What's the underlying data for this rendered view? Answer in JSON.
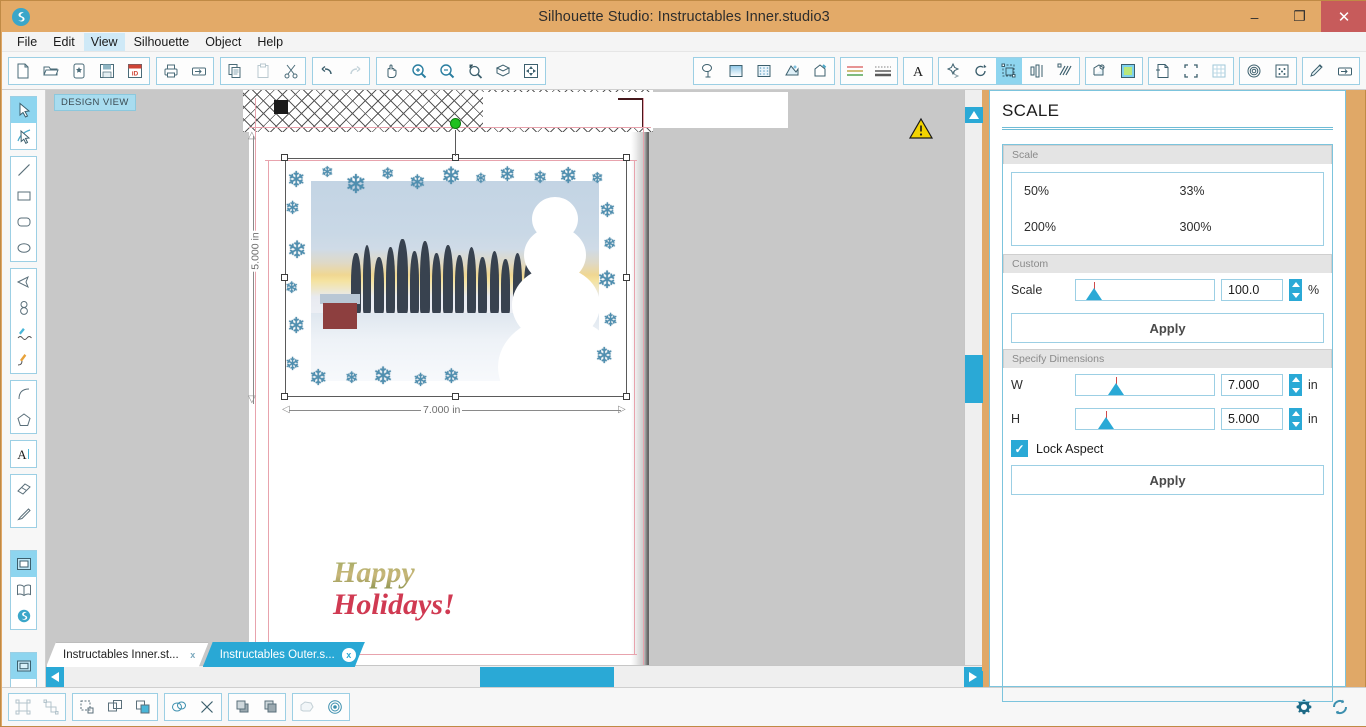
{
  "window": {
    "title": "Silhouette Studio: Instructables Inner.studio3",
    "logo_icon": "silhouette-logo-icon",
    "minimize_label": "–",
    "maximize_label": "❐",
    "close_label": "✕"
  },
  "menu": {
    "items": [
      {
        "label": "File",
        "active": false
      },
      {
        "label": "Edit",
        "active": false
      },
      {
        "label": "View",
        "active": true
      },
      {
        "label": "Silhouette",
        "active": false
      },
      {
        "label": "Object",
        "active": false
      },
      {
        "label": "Help",
        "active": false
      }
    ]
  },
  "toolbar_left": [
    {
      "icons": [
        "new-document-icon",
        "open-folder-icon",
        "open-library-icon",
        "save-icon",
        "save-to-library-icon"
      ]
    },
    {
      "icons": [
        "print-icon",
        "send-to-silhouette-icon"
      ]
    },
    {
      "icons": [
        "copy-icon",
        "paste-icon",
        "cut-scissors-icon"
      ]
    },
    {
      "icons": [
        "undo-icon",
        "redo-icon"
      ]
    },
    {
      "icons": [
        "pan-hand-icon",
        "zoom-in-icon",
        "zoom-out-icon",
        "zoom-selection-icon",
        "zoom-region-icon",
        "fit-to-window-icon"
      ]
    }
  ],
  "toolbar_right": [
    {
      "icons": [
        "cut-settings-icon",
        "fill-color-icon",
        "fill-pattern-icon",
        "fill-gradient-icon",
        "line-color-icon"
      ]
    },
    {
      "icons": [
        "line-style-icon",
        "line-thickness-icon"
      ]
    },
    {
      "icons": [
        "text-style-icon"
      ]
    },
    {
      "icons": [
        "move-icon",
        "rotate-icon",
        "scale-icon",
        "align-icon",
        "replicate-icon"
      ]
    },
    {
      "icons": [
        "offset-icon",
        "trace-icon"
      ]
    },
    {
      "icons": [
        "page-setup-icon",
        "registration-marks-icon",
        "grid-icon"
      ]
    },
    {
      "icons": [
        "sketch-spiral-icon",
        "stipple-icon"
      ]
    },
    {
      "icons": [
        "sketch-pen-icon",
        "send-panel-icon"
      ]
    }
  ],
  "toolbar_selected_icon": "scale-icon",
  "left_palette": [
    {
      "icons": [
        "select-arrow-icon",
        "edit-points-icon"
      ],
      "selected": "select-arrow-icon"
    },
    {
      "icons": [
        "line-tool-icon",
        "rectangle-tool-icon",
        "rounded-rectangle-tool-icon",
        "ellipse-tool-icon"
      ]
    },
    {
      "icons": [
        "polygon-tool-icon",
        "curve-shape-tool-icon",
        "draw-freehand-icon",
        "draw-smooth-icon"
      ]
    },
    {
      "icons": [
        "arc-tool-icon",
        "regular-polygon-tool-icon"
      ]
    },
    {
      "icons": [
        "text-tool-icon"
      ]
    },
    {
      "icons": [
        "eraser-tool-icon",
        "knife-tool-icon"
      ]
    },
    {
      "icons": [
        "design-page-icon",
        "library-book-icon",
        "store-globe-icon"
      ],
      "selected": "design-page-icon"
    },
    {
      "icons": [
        "design-view-icon",
        "send-play-icon"
      ],
      "selected": "design-view-icon"
    }
  ],
  "canvas": {
    "view_badge": "DESIGN VIEW",
    "warning_icon": "warning-triangle-icon",
    "registration_mark_icon": "registration-square-icon",
    "rotate_handle_icon": "rotate-handle-icon",
    "width_dimension": "7.000 in",
    "height_dimension": "5.000 in",
    "greeting_line1": "Happy",
    "greeting_line2": "Holidays!",
    "greeting_color1": "#8d9450",
    "greeting_color2": "#d03a52",
    "artwork_description": "winter-landscape-photo-with-snowflake-border"
  },
  "scrollbars": {
    "expand_panel_icon": "chevron-double-right-icon",
    "up_icon": "▲",
    "down_icon": "▼",
    "left_icon": "◀",
    "right_icon": "▶"
  },
  "doc_tabs": [
    {
      "label": "Instructables Inner.st...",
      "close_label": "x",
      "active": false
    },
    {
      "label": "Instructables Outer.s...",
      "close_label": "x",
      "active": true
    }
  ],
  "bottom_toolbar": [
    {
      "icons": [
        "group-icon",
        "ungroup-icon"
      ]
    },
    {
      "icons": [
        "make-compound-path-icon",
        "release-compound-path-icon",
        "weld-icon"
      ]
    },
    {
      "icons": [
        "merge-icon",
        "crop-icon"
      ]
    },
    {
      "icons": [
        "bring-to-front-icon",
        "send-to-back-icon"
      ]
    },
    {
      "icons": [
        "knife-shape-icon",
        "offset-target-icon"
      ]
    }
  ],
  "bottom_right_icons": [
    "gear-settings-icon",
    "sync-refresh-icon"
  ],
  "panel": {
    "title": "SCALE",
    "scale_section": {
      "header": "Scale",
      "presets": [
        "50%",
        "33%",
        "200%",
        "300%"
      ]
    },
    "custom_section": {
      "header": "Custom",
      "scale_label": "Scale",
      "scale_value": "100.0",
      "scale_unit": "%",
      "apply_label": "Apply"
    },
    "dimensions_section": {
      "header": "Specify Dimensions",
      "width_label": "W",
      "width_value": "7.000",
      "width_unit": "in",
      "height_label": "H",
      "height_value": "5.000",
      "height_unit": "in",
      "lock_aspect_label": "Lock Aspect",
      "lock_aspect_checked": true,
      "lock_check_icon": "✓",
      "apply_label": "Apply"
    }
  },
  "colors": {
    "title_bar": "#e3aa68",
    "accent_blue": "#2aa9d6",
    "panel_border": "#7cc4dd",
    "close_button": "#c75b5b",
    "selection_green": "#1fc11f"
  }
}
